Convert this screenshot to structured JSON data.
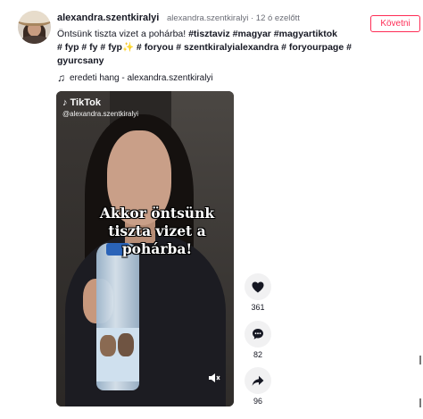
{
  "post": {
    "username": "alexandra.szentkiralyi",
    "meta": "alexandra.szentkiralyi · 12 ó ezelőtt",
    "follow_label": "Követni",
    "caption_intro": "Öntsünk tiszta vizet a pohárba! ",
    "caption_tags_line1": "#tisztaviz #magyar #magyartiktok",
    "caption_line2": "# fyp # fy # fyp✨ # foryou # szentkiralyialexandra # foryourpage #",
    "caption_line3": "gyurcsany",
    "sound_label": "eredeti hang - alexandra.szentkiralyi"
  },
  "video": {
    "brand": "TikTok",
    "handle": "@alexandra.szentkiralyi",
    "overlay_text": "Akkor öntsünk tiszta vizet a pohárba!"
  },
  "actions": {
    "likes": "361",
    "comments": "82",
    "shares": "96"
  },
  "colors": {
    "accent": "#fe2c55",
    "text": "#161823",
    "secondary_text": "#6b6d76",
    "action_bg": "#f1f1f2"
  }
}
